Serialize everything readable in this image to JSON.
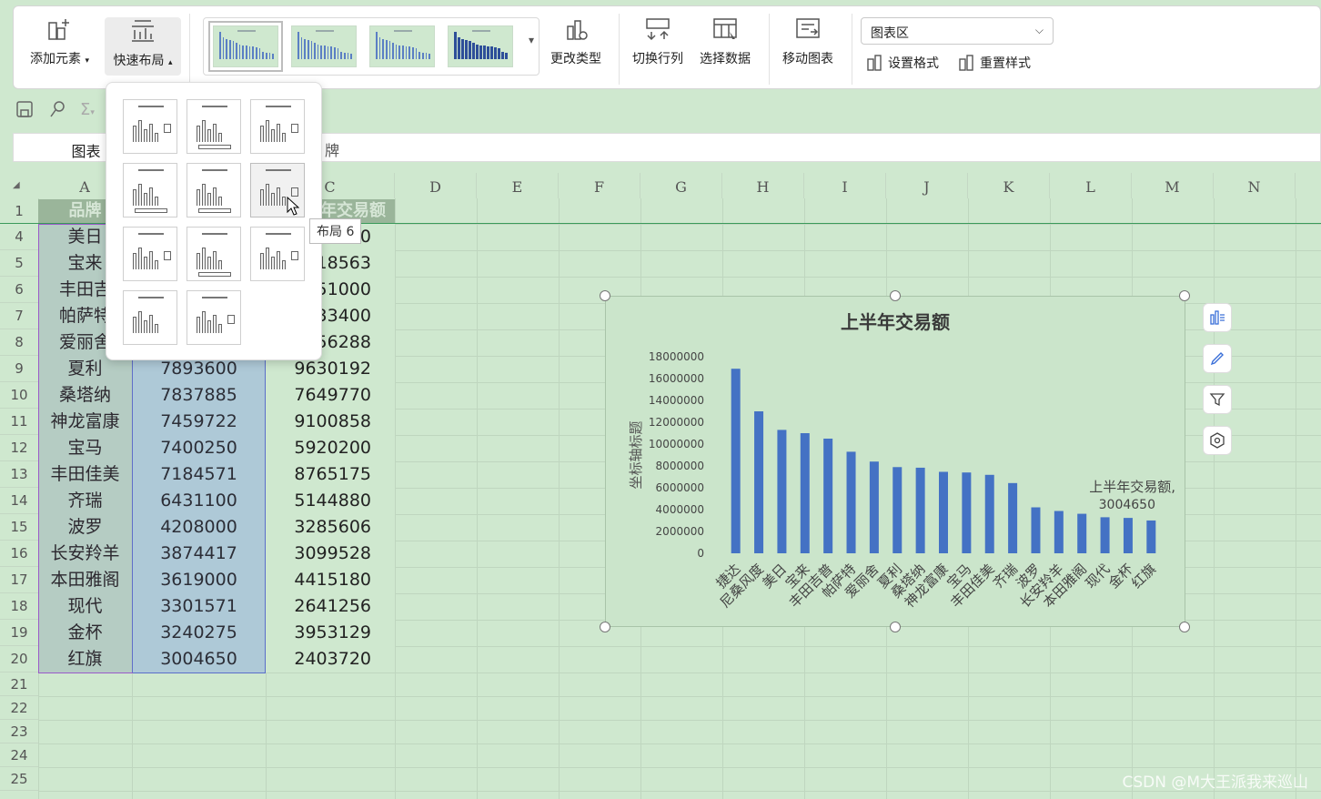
{
  "ribbon": {
    "add_element": "添加元素",
    "quick_layout": "快速布局",
    "change_type": "更改类型",
    "switch_row_col": "切换行列",
    "select_data": "选择数据",
    "move_chart": "移动图表",
    "chart_area_selector": "图表区",
    "set_format": "设置格式",
    "reset_style": "重置样式"
  },
  "namebox": "图表",
  "formula_text": "牌",
  "columns": [
    "A",
    "B",
    "C",
    "D",
    "E",
    "F",
    "G",
    "H",
    "I",
    "J",
    "K",
    "L",
    "M",
    "N"
  ],
  "row_numbers": [
    "1",
    "4",
    "5",
    "6",
    "7",
    "8",
    "9",
    "10",
    "11",
    "12",
    "13",
    "14",
    "15",
    "16",
    "17",
    "18",
    "19",
    "20",
    "21",
    "22",
    "23",
    "24",
    "25"
  ],
  "header_row": {
    "a": "品牌",
    "c": "年交易额"
  },
  "rows": [
    {
      "a": "美日",
      "b": "",
      "c": "0"
    },
    {
      "a": "宝来",
      "b": "",
      "c": "18563"
    },
    {
      "a": "丰田吉",
      "b": "",
      "c": "51000"
    },
    {
      "a": "帕萨特",
      "b": "",
      "c": "33400"
    },
    {
      "a": "爱丽舍",
      "b": "",
      "c": "56288"
    },
    {
      "a": "夏利",
      "b": "7893600",
      "c": "9630192"
    },
    {
      "a": "桑塔纳",
      "b": "7837885",
      "c": "7649770"
    },
    {
      "a": "神龙富康",
      "b": "7459722",
      "c": "9100858"
    },
    {
      "a": "宝马",
      "b": "7400250",
      "c": "5920200"
    },
    {
      "a": "丰田佳美",
      "b": "7184571",
      "c": "8765175"
    },
    {
      "a": "齐瑞",
      "b": "6431100",
      "c": "5144880"
    },
    {
      "a": "波罗",
      "b": "4208000",
      "c": "3285606"
    },
    {
      "a": "长安羚羊",
      "b": "3874417",
      "c": "3099528"
    },
    {
      "a": "本田雅阁",
      "b": "3619000",
      "c": "4415180"
    },
    {
      "a": "现代",
      "b": "3301571",
      "c": "2641256"
    },
    {
      "a": "金杯",
      "b": "3240275",
      "c": "3953129"
    },
    {
      "a": "红旗",
      "b": "3004650",
      "c": "2403720"
    }
  ],
  "tooltip": "布局 6",
  "watermark": "CSDN @M大王派我来巡山",
  "colors": {
    "bar": "#4472c4",
    "sheet_bg": "#cfe8cf",
    "header_bg": "#9ab59a"
  },
  "icons": [
    "add-element-icon",
    "quick-layout-icon",
    "change-type-icon",
    "switch-row-col-icon",
    "select-data-icon",
    "move-chart-icon",
    "set-format-icon",
    "reset-style-icon",
    "save-icon",
    "paint-icon",
    "sum-icon",
    "chart-elements-icon",
    "chart-style-icon",
    "chart-filter-icon",
    "chart-settings-icon"
  ],
  "chart_data": {
    "type": "bar",
    "title": "上半年交易额",
    "ylabel": "坐标轴标题",
    "xlabel": "",
    "categories": [
      "捷达",
      "尼桑风度",
      "美日",
      "宝来",
      "丰田吉普",
      "帕萨特",
      "爱丽舍",
      "夏利",
      "桑塔纳",
      "神龙富康",
      "宝马",
      "丰田佳美",
      "齐瑞",
      "波罗",
      "长安羚羊",
      "本田雅阁",
      "现代",
      "金杯",
      "红旗"
    ],
    "series": [
      {
        "name": "上半年交易额",
        "values": [
          16900000,
          13000000,
          11300000,
          11000000,
          10500000,
          9300000,
          8400000,
          7893600,
          7837885,
          7459722,
          7400250,
          7184571,
          6431100,
          4208000,
          3874417,
          3619000,
          3301571,
          3240275,
          3004650
        ]
      }
    ],
    "yticks": [
      "0",
      "2000000",
      "4000000",
      "6000000",
      "8000000",
      "10000000",
      "12000000",
      "14000000",
      "16000000",
      "18000000"
    ],
    "ylim": [
      0,
      18000000
    ],
    "data_label": {
      "series": "上半年交易额,",
      "value": "3004650"
    }
  }
}
